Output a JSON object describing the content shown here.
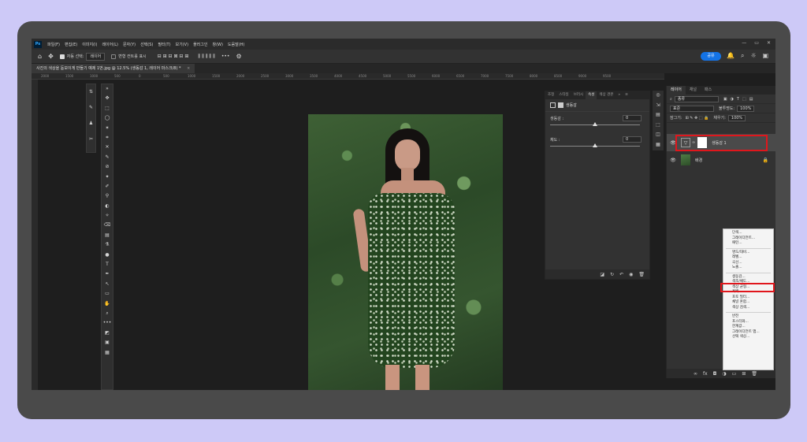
{
  "app": {
    "logo": "Ps",
    "menu": [
      "파일(F)",
      "편집(E)",
      "이미지(I)",
      "레이어(L)",
      "문자(Y)",
      "선택(S)",
      "필터(T)",
      "보기(V)",
      "플러그인",
      "창(W)",
      "도움말(H)"
    ],
    "window_controls": [
      "—",
      "▭",
      "✕"
    ]
  },
  "options_bar": {
    "home_icon": "⌂",
    "move_icon": "✥",
    "auto_select_label": "자동 선택:",
    "auto_select_value": "레이어",
    "transform_controls_label": "변형 컨트롤 표시",
    "more_icon": "•••",
    "settings_icon": "⚙",
    "share_label": "공유",
    "right_icons": [
      "🔔",
      "⌕",
      "☼",
      "▣"
    ]
  },
  "document_tab": {
    "title": "사진의 색상을 돋보이게 만들기 예제 1번.jpg @ 12.5% (생동감 1, 레이어 마스크/8) *",
    "close": "×"
  },
  "ruler": [
    "2000",
    "1500",
    "1000",
    "500",
    "0",
    "500",
    "1000",
    "1500",
    "2000",
    "2500",
    "3000",
    "3500",
    "4000",
    "4500",
    "5000",
    "5500",
    "6000",
    "6500",
    "7000",
    "7500",
    "8000",
    "8500",
    "9000",
    "9500"
  ],
  "toolbar_a": [
    "⇅",
    "✎",
    "♟",
    "✂"
  ],
  "toolbar_b": [
    "»",
    "✥",
    "⬚",
    "◯",
    "✶",
    "⌗",
    "✕",
    "✎",
    "⊘",
    "✦",
    "✐",
    "⚲",
    "◐",
    "✧",
    "⌫",
    "▤",
    "⚗",
    "●",
    "T",
    "✒",
    "↖",
    "▭",
    "✋",
    "⌕",
    "•••",
    "◩",
    "▣",
    "▦"
  ],
  "properties": {
    "tabs": [
      "조정",
      "스타일",
      "브러시",
      "속성",
      "색상 견본"
    ],
    "more": "»",
    "menu": "≡",
    "title": "생동감",
    "sliders": [
      {
        "label": "생동감 :",
        "value": "0"
      },
      {
        "label": "채도 :",
        "value": "0"
      }
    ],
    "footer_icons": [
      "◪",
      "↻",
      "↶",
      "◉",
      "🗑"
    ]
  },
  "icon_column": [
    "◎",
    "⇲",
    "▤",
    "⬚",
    "◫",
    "▦"
  ],
  "layers": {
    "tabs": [
      "레이어",
      "채널",
      "패스"
    ],
    "filter_label": "종류",
    "filter_icons": [
      "▣",
      "◑",
      "T",
      "⬚",
      "▤"
    ],
    "blend_mode": "표준",
    "opacity_label": "불투명도:",
    "opacity_value": "100%",
    "lock_label": "잠그기:",
    "fill_label": "채우기:",
    "fill_value": "100%",
    "items": [
      {
        "name": "생동감 1",
        "type": "adjustment"
      },
      {
        "name": "배경",
        "type": "image"
      }
    ],
    "eye_icon": "👁",
    "adj_icon": "▽",
    "chain_icon": "∞",
    "lock_icon": "🔒",
    "footer_icons": [
      "∞",
      "fx",
      "◘",
      "◑",
      "▭",
      "⊞",
      "🗑"
    ]
  },
  "adjust_menu": {
    "groups": [
      [
        "단색...",
        "그레이디언트...",
        "패턴..."
      ],
      [
        "명도/대비...",
        "레벨...",
        "곡선...",
        "노출..."
      ],
      [
        "생동감...",
        "색조/채도...",
        "색상 균형...",
        "흑백...",
        "포토 필터...",
        "채널 혼합...",
        "색상 검색..."
      ],
      [
        "반전",
        "포스터화...",
        "한계값...",
        "그레이디언트 맵...",
        "선택 색상..."
      ]
    ]
  }
}
